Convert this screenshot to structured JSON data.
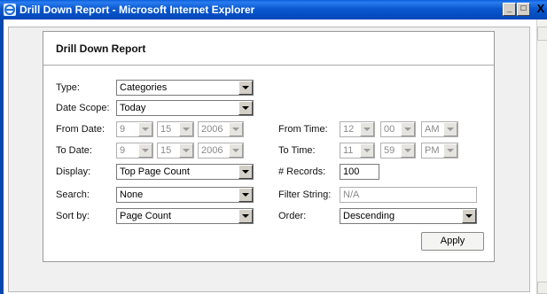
{
  "window": {
    "title": "Drill Down Report - Microsoft Internet Explorer",
    "min_label": "_",
    "max_label": "□",
    "close_label": "X"
  },
  "report": {
    "title": "Drill Down Report",
    "labels": {
      "type": "Type:",
      "date_scope": "Date Scope:",
      "from_date": "From Date:",
      "to_date": "To Date:",
      "display": "Display:",
      "search": "Search:",
      "sort_by": "Sort by:",
      "from_time": "From Time:",
      "to_time": "To Time:",
      "records": "# Records:",
      "filter_string": "Filter String:",
      "order": "Order:"
    },
    "values": {
      "type": "Categories",
      "date_scope": "Today",
      "from_date": {
        "month": "9",
        "day": "15",
        "year": "2006"
      },
      "to_date": {
        "month": "9",
        "day": "15",
        "year": "2006"
      },
      "display": "Top Page Count",
      "search": "None",
      "sort_by": "Page Count",
      "from_time": {
        "hour": "12",
        "minute": "00",
        "ampm": "AM"
      },
      "to_time": {
        "hour": "11",
        "minute": "59",
        "ampm": "PM"
      },
      "records": "100",
      "filter_string": "N/A",
      "order": "Descending"
    },
    "apply_label": "Apply"
  }
}
